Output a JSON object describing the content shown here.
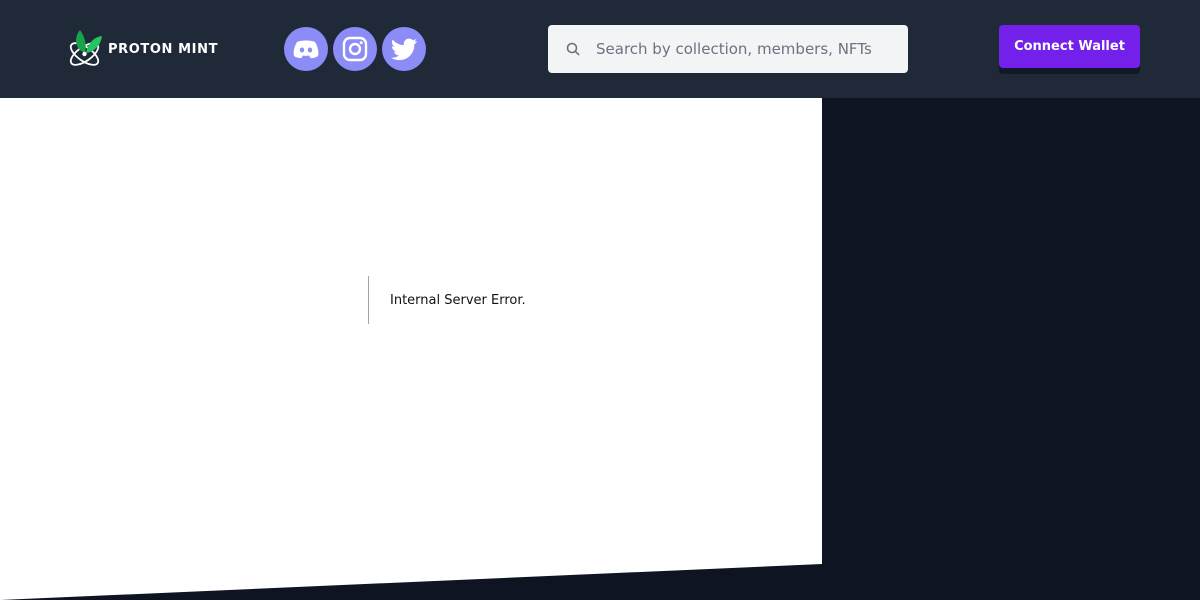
{
  "header": {
    "logo_text": "PROTON MINT",
    "social_links": [
      {
        "name": "discord",
        "icon": "discord-icon"
      },
      {
        "name": "instagram",
        "icon": "instagram-icon"
      },
      {
        "name": "twitter",
        "icon": "twitter-icon"
      }
    ],
    "search": {
      "placeholder": "Search by collection, members, NFTs",
      "value": "",
      "icon": "search-icon"
    },
    "connect_wallet_label": "Connect Wallet"
  },
  "main": {
    "error_message": "Internal Server Error."
  },
  "colors": {
    "header_bg": "#1f2937",
    "dark_bg": "#0f1422",
    "social_bg": "#8b8cf6",
    "accent": "#7220ea",
    "leaf_green": "#16a34a"
  }
}
